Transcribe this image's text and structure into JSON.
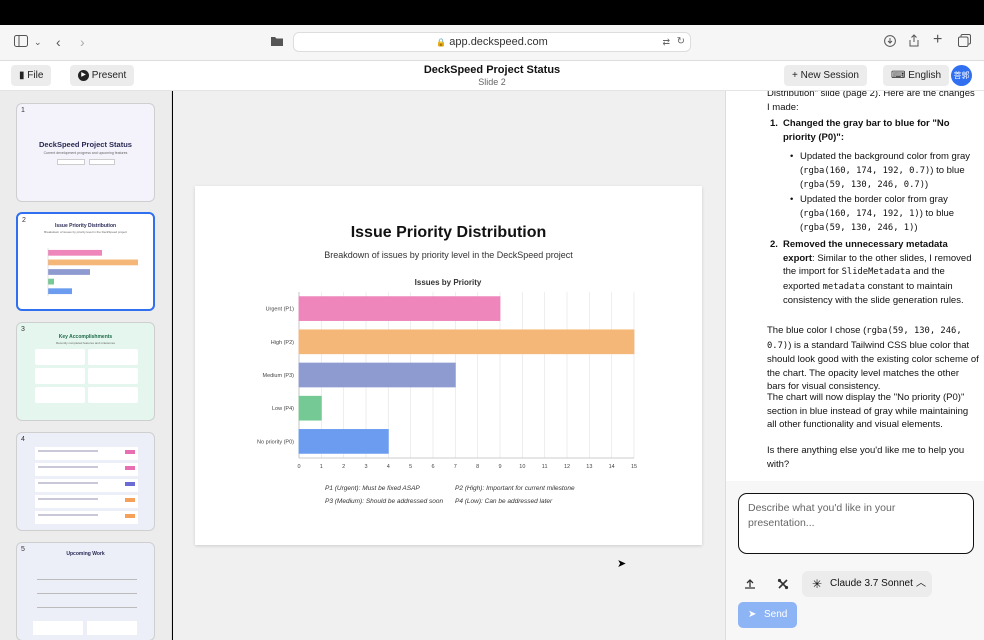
{
  "browser": {
    "url": "app.deckspeed.com"
  },
  "header": {
    "file_label": "File",
    "present_label": "Present",
    "title": "DeckSpeed Project Status",
    "subtitle": "Slide 2",
    "new_session_label": "New Session",
    "language_label": "English",
    "avatar_text": "菩郭"
  },
  "sidebar": {
    "slides": [
      {
        "num": "1",
        "title": "DeckSpeed Project Status",
        "subtitle": "Current development progress and upcoming features",
        "bg": "#ece9fb"
      },
      {
        "num": "2",
        "title": "Issue Priority Distribution",
        "subtitle": "Breakdown of issues by priority level in the DeckSpeed project",
        "bg": "#ffffff"
      },
      {
        "num": "3",
        "title": "Key Accomplishments",
        "subtitle": "Recently completed features and milestones",
        "bg": "#e4f6ee"
      },
      {
        "num": "4",
        "title": "",
        "subtitle": "",
        "bg": "#eceff8"
      },
      {
        "num": "5",
        "title": "Upcoming Work",
        "subtitle": "",
        "bg": "#eceff8"
      }
    ]
  },
  "slide": {
    "title": "Issue Priority Distribution",
    "subtitle": "Breakdown of issues by priority level in the DeckSpeed project",
    "legend_notes": [
      "P1 (Urgent): Must be fixed ASAP",
      "P2 (High): Important for current milestone",
      "P3 (Medium): Should be addressed soon",
      "P4 (Low): Can be addressed later"
    ]
  },
  "chart_data": {
    "type": "bar",
    "orientation": "horizontal",
    "title": "Issues by Priority",
    "categories": [
      "Urgent (P1)",
      "High (P2)",
      "Medium (P3)",
      "Low (P4)",
      "No priority (P0)"
    ],
    "values": [
      9,
      15,
      7,
      1,
      4
    ],
    "colors": [
      "#ee86bb",
      "#f5b778",
      "#8e9bd1",
      "#74c995",
      "#6b9cf0"
    ],
    "xlim": [
      0,
      15
    ],
    "xticks": [
      "0",
      "1",
      "2",
      "3",
      "4",
      "5",
      "6",
      "7",
      "8",
      "9",
      "10",
      "11",
      "12",
      "13",
      "14",
      "15"
    ],
    "grid": true
  },
  "chat": {
    "intro": "Distribution\" slide (page 2). Here are the changes I made:",
    "item1_title": "Changed the gray bar to blue for \"No priority (P0)\"",
    "item1_b1_a": "Updated the background color from gray (",
    "item1_b1_code1": "rgba(160, 174, 192, 0.7)",
    "item1_b1_b": ") to blue (",
    "item1_b1_code2": "rgba(59, 130, 246, 0.7)",
    "item1_b1_c": ")",
    "item1_b2_a": "Updated the border color from gray (",
    "item1_b2_code1": "rgba(160, 174, 192, 1)",
    "item1_b2_b": ") to blue (",
    "item1_b2_code2": "rgba(59, 130, 246, 1)",
    "item1_b2_c": ")",
    "item2_title": "Removed the unnecessary metadata export",
    "item2_a": ": Similar to the other slides, I removed the import for ",
    "item2_code1": "SlideMetadata",
    "item2_b": " and the exported ",
    "item2_code2": "metadata",
    "item2_c": " constant to maintain consistency with the slide generation rules.",
    "para1_a": "The blue color I chose (",
    "para1_code": "rgba(59, 130, 246, 0.7)",
    "para1_b": ") is a standard Tailwind CSS blue color that should look good with the existing color scheme of the chart. The opacity level matches the other bars for visual consistency.",
    "para2": "The chart will now display the \"No priority (P0)\" section in blue instead of gray while maintaining all other functionality and visual elements.",
    "para3": "Is there anything else you'd like me to help you with?",
    "input_placeholder": "Describe what you'd like in your presentation...",
    "model_label": "Claude 3.7 Sonnet",
    "send_label": "Send"
  }
}
